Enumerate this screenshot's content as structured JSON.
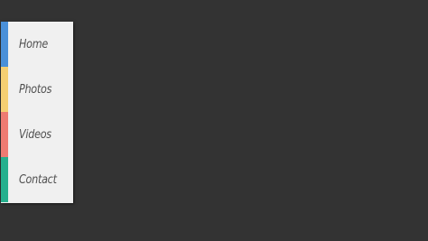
{
  "menu": {
    "items": [
      {
        "label": "Home",
        "accent": "#4a90d9"
      },
      {
        "label": "Photos",
        "accent": "#f5cf72"
      },
      {
        "label": "Videos",
        "accent": "#ee7b72"
      },
      {
        "label": "Contact",
        "accent": "#26b08e"
      }
    ]
  }
}
